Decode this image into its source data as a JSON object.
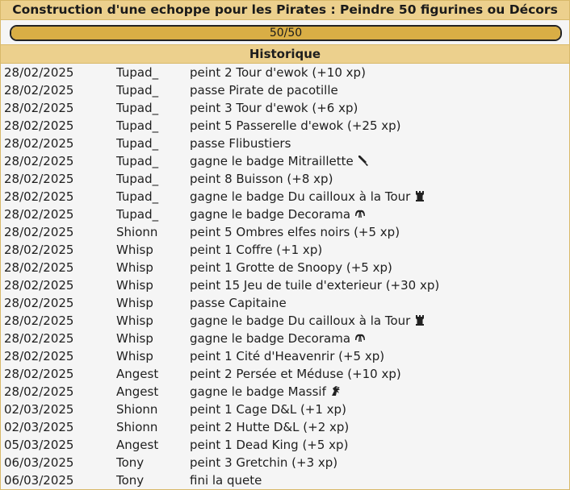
{
  "title": "Construction d'une echoppe pour les Pirates : Peindre 50 figurines ou Décors",
  "progress": {
    "label": "50/50",
    "value": 50,
    "max": 50
  },
  "history": {
    "header": "Historique",
    "rows": [
      {
        "date": "28/02/2025",
        "user": "Tupad_",
        "text": "peint 2 Tour d'ewok (+10 xp)",
        "icon": ""
      },
      {
        "date": "28/02/2025",
        "user": "Tupad_",
        "text": "passe Pirate de pacotille",
        "icon": ""
      },
      {
        "date": "28/02/2025",
        "user": "Tupad_",
        "text": "peint 3 Tour d'ewok (+6 xp)",
        "icon": ""
      },
      {
        "date": "28/02/2025",
        "user": "Tupad_",
        "text": "peint 5 Passerelle d'ewok (+25 xp)",
        "icon": ""
      },
      {
        "date": "28/02/2025",
        "user": "Tupad_",
        "text": "passe Flibustiers",
        "icon": ""
      },
      {
        "date": "28/02/2025",
        "user": "Tupad_",
        "text": "gagne le badge Mitraillette",
        "icon": "brush-icon"
      },
      {
        "date": "28/02/2025",
        "user": "Tupad_",
        "text": "peint 8 Buisson (+8 xp)",
        "icon": ""
      },
      {
        "date": "28/02/2025",
        "user": "Tupad_",
        "text": "gagne le badge Du cailloux à la Tour",
        "icon": "tower-icon"
      },
      {
        "date": "28/02/2025",
        "user": "Tupad_",
        "text": "gagne le badge Decorama",
        "icon": "palm-icon"
      },
      {
        "date": "28/02/2025",
        "user": "Shionn",
        "text": "peint 5 Ombres elfes noirs (+5 xp)",
        "icon": ""
      },
      {
        "date": "28/02/2025",
        "user": "Whisp",
        "text": "peint 1 Coffre (+1 xp)",
        "icon": ""
      },
      {
        "date": "28/02/2025",
        "user": "Whisp",
        "text": "peint 1 Grotte de Snoopy (+5 xp)",
        "icon": ""
      },
      {
        "date": "28/02/2025",
        "user": "Whisp",
        "text": "peint 15 Jeu de tuile d'exterieur (+30 xp)",
        "icon": ""
      },
      {
        "date": "28/02/2025",
        "user": "Whisp",
        "text": "passe Capitaine",
        "icon": ""
      },
      {
        "date": "28/02/2025",
        "user": "Whisp",
        "text": "gagne le badge Du cailloux à la Tour",
        "icon": "tower-icon"
      },
      {
        "date": "28/02/2025",
        "user": "Whisp",
        "text": "gagne le badge Decorama",
        "icon": "palm-icon"
      },
      {
        "date": "28/02/2025",
        "user": "Whisp",
        "text": "peint 1 Cité d'Heavenrir (+5 xp)",
        "icon": ""
      },
      {
        "date": "28/02/2025",
        "user": "Angest",
        "text": "peint 2 Persée et Méduse (+10 xp)",
        "icon": ""
      },
      {
        "date": "28/02/2025",
        "user": "Angest",
        "text": "gagne le badge Massif",
        "icon": "dragon-icon"
      },
      {
        "date": "02/03/2025",
        "user": "Shionn",
        "text": "peint 1 Cage D&L (+1 xp)",
        "icon": ""
      },
      {
        "date": "02/03/2025",
        "user": "Shionn",
        "text": "peint 2 Hutte D&L (+2 xp)",
        "icon": ""
      },
      {
        "date": "05/03/2025",
        "user": "Angest",
        "text": "peint 1 Dead King (+5 xp)",
        "icon": ""
      },
      {
        "date": "06/03/2025",
        "user": "Tony",
        "text": "peint 3 Gretchin (+3 xp)",
        "icon": ""
      },
      {
        "date": "06/03/2025",
        "user": "Tony",
        "text": "fini la quete",
        "icon": ""
      }
    ]
  }
}
